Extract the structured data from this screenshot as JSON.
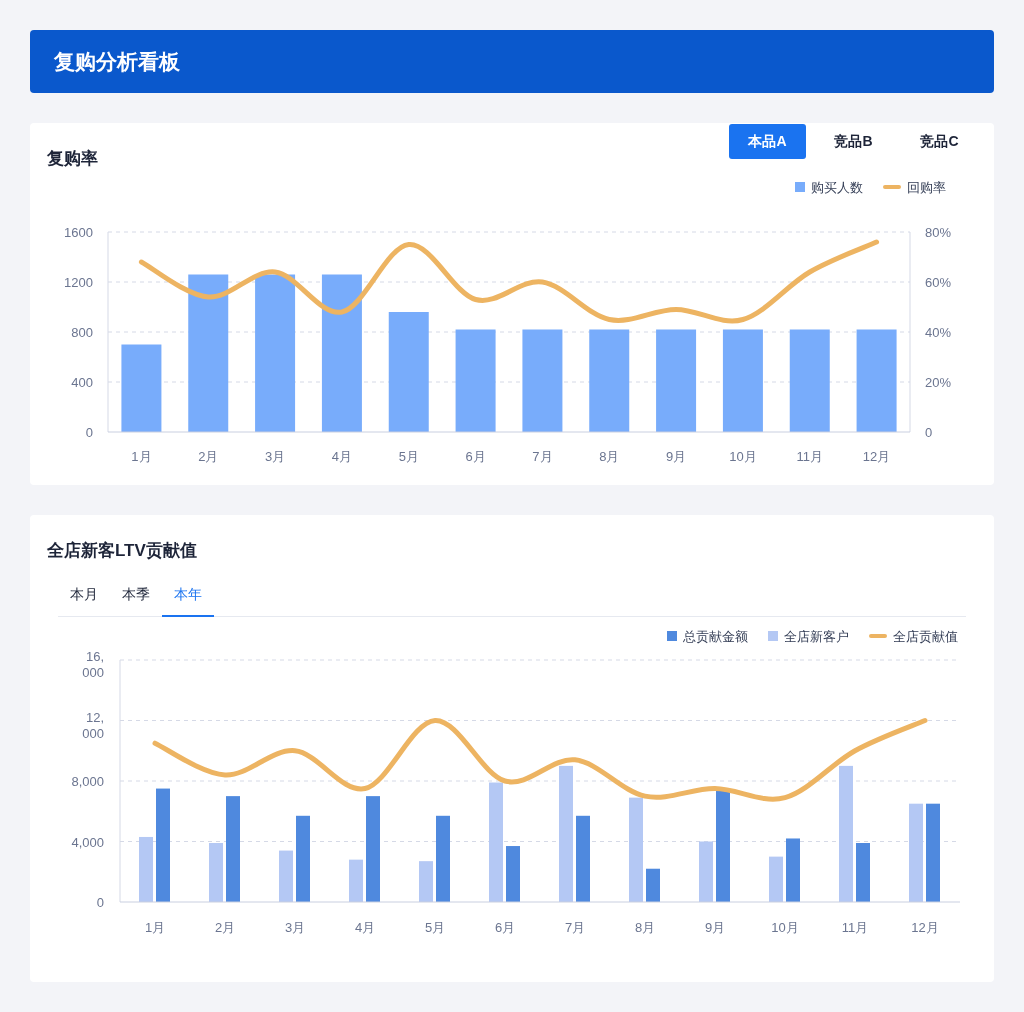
{
  "header": {
    "title": "复购分析看板"
  },
  "repurchase": {
    "title": "复购率",
    "tabs": [
      {
        "label": "本品A",
        "selected": true
      },
      {
        "label": "竞品B",
        "selected": false
      },
      {
        "label": "竞品C",
        "selected": false
      }
    ],
    "chart_data": {
      "type": "bar",
      "grid": true,
      "categories": [
        "1月",
        "2月",
        "3月",
        "4月",
        "5月",
        "6月",
        "7月",
        "8月",
        "9月",
        "10月",
        "11月",
        "12月"
      ],
      "series": [
        {
          "name": "购买人数",
          "color": "#78acfb",
          "type": "bar",
          "values": [
            700,
            1260,
            1260,
            1260,
            960,
            820,
            820,
            820,
            820,
            820,
            820,
            820
          ]
        },
        {
          "name": "回购率",
          "color": "#edb462",
          "type": "line",
          "axis": "y2",
          "values": [
            68,
            54,
            64,
            48,
            75,
            53,
            60,
            45,
            49,
            45,
            64,
            76
          ]
        }
      ],
      "ylim": [
        0,
        1600
      ],
      "yticks": [
        0,
        400,
        800,
        1200,
        1600
      ],
      "y2lim": [
        0,
        80
      ],
      "y2ticks": [
        {
          "value": 0,
          "label": "0"
        },
        {
          "value": 20,
          "label": "20%"
        },
        {
          "value": 40,
          "label": "40%"
        },
        {
          "value": 60,
          "label": "60%"
        },
        {
          "value": 80,
          "label": "80%"
        }
      ]
    }
  },
  "ltv": {
    "title": "全店新客LTV贡献值",
    "tabs": [
      {
        "label": "本月",
        "selected": false
      },
      {
        "label": "本季",
        "selected": false
      },
      {
        "label": "本年",
        "selected": true
      }
    ],
    "chart_data": {
      "type": "bar",
      "grid": true,
      "categories": [
        "1月",
        "2月",
        "3月",
        "4月",
        "5月",
        "6月",
        "7月",
        "8月",
        "9月",
        "10月",
        "11月",
        "12月"
      ],
      "series": [
        {
          "name": "总贡献金额",
          "color": "#4f89de",
          "type": "bar",
          "values": [
            7500,
            7000,
            5700,
            7000,
            5700,
            3700,
            5700,
            2200,
            7500,
            4200,
            3900,
            6500
          ]
        },
        {
          "name": "全店新客户",
          "color": "#b4c8f4",
          "type": "bar",
          "values": [
            4300,
            3900,
            3400,
            2800,
            2700,
            7900,
            9000,
            6900,
            4000,
            3000,
            9000,
            6500
          ]
        },
        {
          "name": "全店贡献值",
          "color": "#edb462",
          "type": "line",
          "values": [
            10500,
            8400,
            10000,
            7500,
            12000,
            8000,
            9400,
            7000,
            7500,
            6900,
            10000,
            12000
          ]
        }
      ],
      "ylim": [
        0,
        16000
      ],
      "yticks": [
        {
          "value": 0,
          "label": "0"
        },
        {
          "value": 4000,
          "label": "4,000"
        },
        {
          "value": 8000,
          "label": "8,000"
        },
        {
          "value": 12000,
          "label": "12,000"
        },
        {
          "value": 16000,
          "label": "16,000"
        }
      ]
    }
  }
}
